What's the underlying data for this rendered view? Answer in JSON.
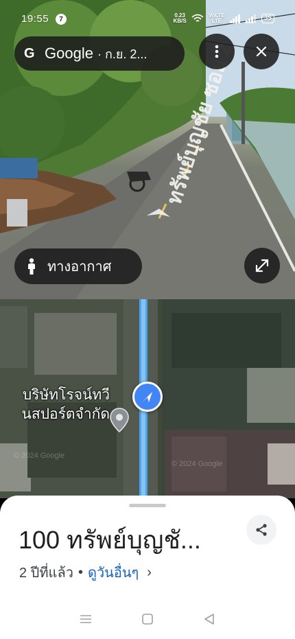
{
  "status_bar": {
    "time": "19:55",
    "notification_count": "7",
    "net_speed": "0.23",
    "net_unit": "KB/S",
    "volte_top": "VoLTE",
    "volte_bottom": "LTE",
    "battery": "35"
  },
  "streetview": {
    "brand": "Google",
    "date_label": "· ก.ย. 2...",
    "aerial_label": "ทางอากาศ",
    "road_marking": "ทรัพย์บุญชัย ซอย 2"
  },
  "map": {
    "place_label_line1": "บริษัทโรจน์ทวี",
    "place_label_line2": "นสปอร์ตจำกัด",
    "watermark": "© 2024 Google"
  },
  "sheet": {
    "title": "100 ทรัพย์บุญชั...",
    "age": "2 ปีที่แล้ว",
    "separator": "•",
    "more_link": "ดูวันอื่นๆ",
    "chevron": "›"
  },
  "colors": {
    "accent": "#4285f4",
    "pill_bg": "#1c1c1c",
    "sheet_bg": "#ffffff",
    "link": "#1565c0"
  },
  "icons": [
    "more-vert-icon",
    "close-icon",
    "person-icon",
    "expand-icon",
    "navigation-arrow-icon",
    "location-pin-icon",
    "share-icon",
    "menu-icon",
    "home-square-icon",
    "back-triangle-icon"
  ]
}
